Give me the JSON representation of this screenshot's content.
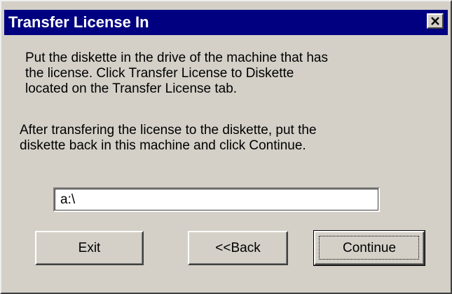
{
  "window": {
    "title": "Transfer License In",
    "title_bar_color": "#000080",
    "close_icon": "close-icon"
  },
  "message": {
    "paragraph1_line1": "Put the diskette in the drive of the machine that has",
    "paragraph1_line2": "the license. Click Transfer License to Diskette",
    "paragraph1_line3": "located on the Transfer License tab.",
    "paragraph2_line1": "After transfering the license to the diskette, put the",
    "paragraph2_line2": "diskette back in this machine and click Continue."
  },
  "path_field": {
    "value": "a:\\"
  },
  "buttons": {
    "exit": "Exit",
    "back": "<<Back",
    "continue": "Continue"
  }
}
